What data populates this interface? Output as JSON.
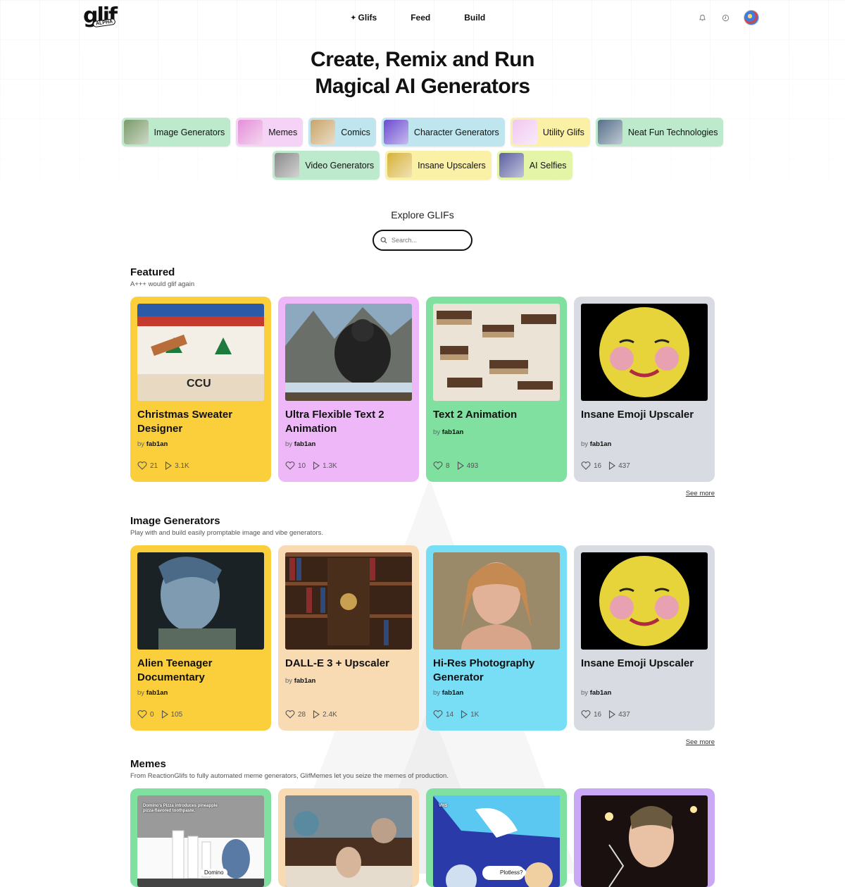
{
  "header": {
    "logo_text": "glif",
    "logo_tag": "ALPHA",
    "nav": [
      {
        "label": "Glifs",
        "active": true
      },
      {
        "label": "Feed",
        "active": false
      },
      {
        "label": "Build",
        "active": false
      }
    ],
    "icons": [
      "bell-icon",
      "clock-icon"
    ],
    "avatar": "user-avatar"
  },
  "hero": {
    "line1": "Create, Remix and Run",
    "line2": "Magical AI Generators"
  },
  "categories_row1": [
    {
      "label": "Image Generators",
      "color": "#bde9cd",
      "thumb": "#7a9a6a"
    },
    {
      "label": "Memes",
      "color": "#f5d3f7",
      "thumb": "#e48fd8"
    },
    {
      "label": "Comics",
      "color": "#bfe6ef",
      "thumb": "#c9a46a"
    },
    {
      "label": "Character Generators",
      "color": "#bfe6ef",
      "thumb": "#6b4bd1"
    },
    {
      "label": "Utility Glifs",
      "color": "#faf0a6",
      "thumb": "#f0c8f0"
    },
    {
      "label": "Neat Fun Technologies",
      "color": "#bde9cd",
      "thumb": "#56708a"
    }
  ],
  "categories_row2": [
    {
      "label": "Video Generators",
      "color": "#bde9cd",
      "thumb": "#8a8a8a"
    },
    {
      "label": "Insane Upscalers",
      "color": "#faf0a6",
      "thumb": "#d7b238"
    },
    {
      "label": "AI Selfies",
      "color": "#e5f5a8",
      "thumb": "#5a5fa0"
    }
  ],
  "explore": {
    "title": "Explore GLIFs",
    "search_placeholder": "Search..."
  },
  "sections": {
    "featured": {
      "title": "Featured",
      "subtitle": "A+++ would glif again",
      "see_more": "See more",
      "cards": [
        {
          "title": "Christmas Sweater Designer",
          "by": "by",
          "author": "fab1an",
          "likes": "21",
          "runs": "3.1K",
          "color": "#fbcf3c"
        },
        {
          "title": "Ultra Flexible Text 2 Animation",
          "by": "by",
          "author": "fab1an",
          "likes": "10",
          "runs": "1.3K",
          "color": "#eeb8f8"
        },
        {
          "title": "Text 2 Animation",
          "by": "by",
          "author": "fab1an",
          "likes": "8",
          "runs": "493",
          "color": "#7fe0a0"
        },
        {
          "title": "Insane Emoji Upscaler",
          "by": "by",
          "author": "fab1an",
          "likes": "16",
          "runs": "437",
          "color": "#d8dbe2"
        }
      ]
    },
    "image_generators": {
      "title": "Image Generators",
      "subtitle": "Play with and build easily promptable image and vibe generators.",
      "see_more": "See more",
      "cards": [
        {
          "title": "Alien Teenager Documentary",
          "by": "by",
          "author": "fab1an",
          "likes": "0",
          "runs": "105",
          "color": "#fbcf3c"
        },
        {
          "title": "DALL-E 3 + Upscaler",
          "by": "by",
          "author": "fab1an",
          "likes": "28",
          "runs": "2.4K",
          "color": "#f9dbb3"
        },
        {
          "title": "Hi-Res Photography Generator",
          "by": "by",
          "author": "fab1an",
          "likes": "14",
          "runs": "1K",
          "color": "#77def6"
        },
        {
          "title": "Insane Emoji Upscaler",
          "by": "by",
          "author": "fab1an",
          "likes": "16",
          "runs": "437",
          "color": "#d8dbe2"
        }
      ]
    },
    "memes": {
      "title": "Memes",
      "subtitle": "From ReactionGlifs to fully automated meme generators, GlifMemes let you seize the memes of production.",
      "cards": [
        {
          "color": "#7fe0a0",
          "caption": "Domino's Pizza introduces pineapple pizza-flavored toothpaste.",
          "caption2": "Domino"
        },
        {
          "color": "#f9dbb3"
        },
        {
          "color": "#7fe0a0",
          "caption": "VHS",
          "caption2": "Plotless?"
        },
        {
          "color": "#c9a8f5"
        }
      ]
    }
  }
}
